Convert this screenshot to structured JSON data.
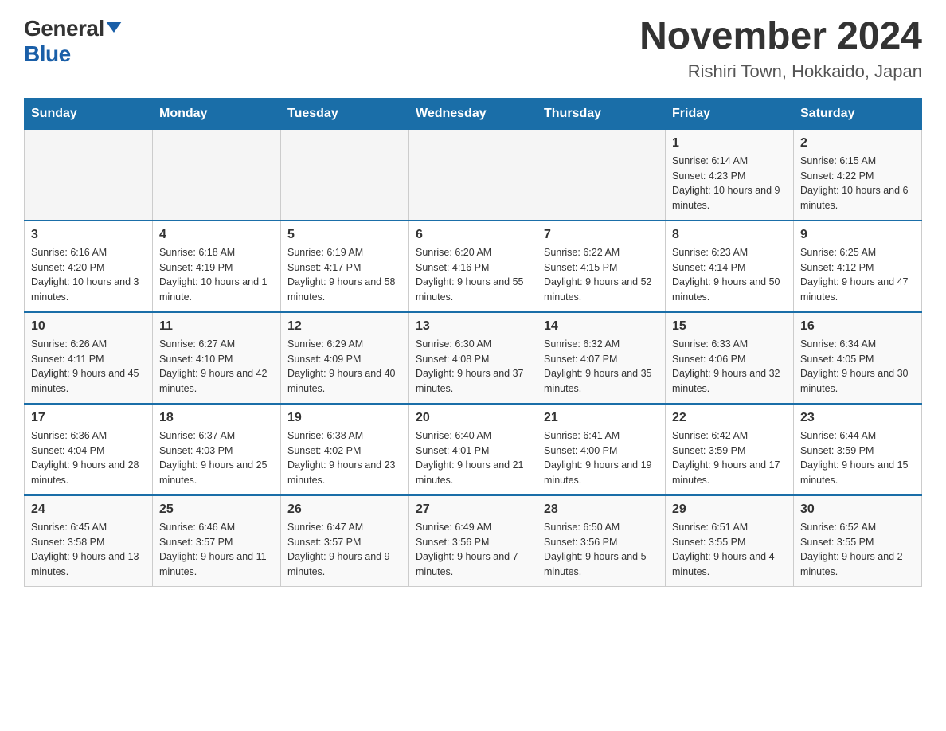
{
  "header": {
    "logo_general": "General",
    "logo_blue": "Blue",
    "month_title": "November 2024",
    "location": "Rishiri Town, Hokkaido, Japan"
  },
  "weekdays": [
    "Sunday",
    "Monday",
    "Tuesday",
    "Wednesday",
    "Thursday",
    "Friday",
    "Saturday"
  ],
  "weeks": [
    {
      "days": [
        {
          "number": "",
          "info": ""
        },
        {
          "number": "",
          "info": ""
        },
        {
          "number": "",
          "info": ""
        },
        {
          "number": "",
          "info": ""
        },
        {
          "number": "",
          "info": ""
        },
        {
          "number": "1",
          "info": "Sunrise: 6:14 AM\nSunset: 4:23 PM\nDaylight: 10 hours and 9 minutes."
        },
        {
          "number": "2",
          "info": "Sunrise: 6:15 AM\nSunset: 4:22 PM\nDaylight: 10 hours and 6 minutes."
        }
      ]
    },
    {
      "days": [
        {
          "number": "3",
          "info": "Sunrise: 6:16 AM\nSunset: 4:20 PM\nDaylight: 10 hours and 3 minutes."
        },
        {
          "number": "4",
          "info": "Sunrise: 6:18 AM\nSunset: 4:19 PM\nDaylight: 10 hours and 1 minute."
        },
        {
          "number": "5",
          "info": "Sunrise: 6:19 AM\nSunset: 4:17 PM\nDaylight: 9 hours and 58 minutes."
        },
        {
          "number": "6",
          "info": "Sunrise: 6:20 AM\nSunset: 4:16 PM\nDaylight: 9 hours and 55 minutes."
        },
        {
          "number": "7",
          "info": "Sunrise: 6:22 AM\nSunset: 4:15 PM\nDaylight: 9 hours and 52 minutes."
        },
        {
          "number": "8",
          "info": "Sunrise: 6:23 AM\nSunset: 4:14 PM\nDaylight: 9 hours and 50 minutes."
        },
        {
          "number": "9",
          "info": "Sunrise: 6:25 AM\nSunset: 4:12 PM\nDaylight: 9 hours and 47 minutes."
        }
      ]
    },
    {
      "days": [
        {
          "number": "10",
          "info": "Sunrise: 6:26 AM\nSunset: 4:11 PM\nDaylight: 9 hours and 45 minutes."
        },
        {
          "number": "11",
          "info": "Sunrise: 6:27 AM\nSunset: 4:10 PM\nDaylight: 9 hours and 42 minutes."
        },
        {
          "number": "12",
          "info": "Sunrise: 6:29 AM\nSunset: 4:09 PM\nDaylight: 9 hours and 40 minutes."
        },
        {
          "number": "13",
          "info": "Sunrise: 6:30 AM\nSunset: 4:08 PM\nDaylight: 9 hours and 37 minutes."
        },
        {
          "number": "14",
          "info": "Sunrise: 6:32 AM\nSunset: 4:07 PM\nDaylight: 9 hours and 35 minutes."
        },
        {
          "number": "15",
          "info": "Sunrise: 6:33 AM\nSunset: 4:06 PM\nDaylight: 9 hours and 32 minutes."
        },
        {
          "number": "16",
          "info": "Sunrise: 6:34 AM\nSunset: 4:05 PM\nDaylight: 9 hours and 30 minutes."
        }
      ]
    },
    {
      "days": [
        {
          "number": "17",
          "info": "Sunrise: 6:36 AM\nSunset: 4:04 PM\nDaylight: 9 hours and 28 minutes."
        },
        {
          "number": "18",
          "info": "Sunrise: 6:37 AM\nSunset: 4:03 PM\nDaylight: 9 hours and 25 minutes."
        },
        {
          "number": "19",
          "info": "Sunrise: 6:38 AM\nSunset: 4:02 PM\nDaylight: 9 hours and 23 minutes."
        },
        {
          "number": "20",
          "info": "Sunrise: 6:40 AM\nSunset: 4:01 PM\nDaylight: 9 hours and 21 minutes."
        },
        {
          "number": "21",
          "info": "Sunrise: 6:41 AM\nSunset: 4:00 PM\nDaylight: 9 hours and 19 minutes."
        },
        {
          "number": "22",
          "info": "Sunrise: 6:42 AM\nSunset: 3:59 PM\nDaylight: 9 hours and 17 minutes."
        },
        {
          "number": "23",
          "info": "Sunrise: 6:44 AM\nSunset: 3:59 PM\nDaylight: 9 hours and 15 minutes."
        }
      ]
    },
    {
      "days": [
        {
          "number": "24",
          "info": "Sunrise: 6:45 AM\nSunset: 3:58 PM\nDaylight: 9 hours and 13 minutes."
        },
        {
          "number": "25",
          "info": "Sunrise: 6:46 AM\nSunset: 3:57 PM\nDaylight: 9 hours and 11 minutes."
        },
        {
          "number": "26",
          "info": "Sunrise: 6:47 AM\nSunset: 3:57 PM\nDaylight: 9 hours and 9 minutes."
        },
        {
          "number": "27",
          "info": "Sunrise: 6:49 AM\nSunset: 3:56 PM\nDaylight: 9 hours and 7 minutes."
        },
        {
          "number": "28",
          "info": "Sunrise: 6:50 AM\nSunset: 3:56 PM\nDaylight: 9 hours and 5 minutes."
        },
        {
          "number": "29",
          "info": "Sunrise: 6:51 AM\nSunset: 3:55 PM\nDaylight: 9 hours and 4 minutes."
        },
        {
          "number": "30",
          "info": "Sunrise: 6:52 AM\nSunset: 3:55 PM\nDaylight: 9 hours and 2 minutes."
        }
      ]
    }
  ]
}
